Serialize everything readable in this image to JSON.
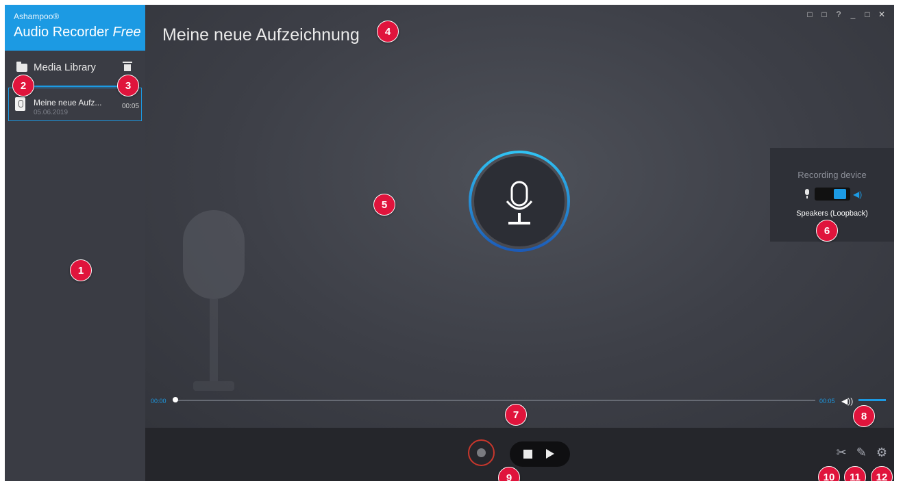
{
  "app": {
    "vendor": "Ashampoo®",
    "name": "Audio Recorder",
    "edition": "Free"
  },
  "library": {
    "label": "Media Library"
  },
  "recordings": [
    {
      "title": "Meine neue Aufz...",
      "date": "05.06.2019",
      "duration": "00:05"
    }
  ],
  "main": {
    "title": "Meine neue Aufzeichnung"
  },
  "device": {
    "header": "Recording device",
    "name": "Speakers (Loopback)"
  },
  "timeline": {
    "start": "00:00",
    "end": "00:05"
  },
  "window_controls": [
    "□",
    "□",
    "?",
    "_",
    "□",
    "✕"
  ],
  "badges": [
    "1",
    "2",
    "3",
    "4",
    "5",
    "6",
    "7",
    "8",
    "9",
    "10",
    "11",
    "12"
  ],
  "colors": {
    "accent": "#1c9ae3",
    "record": "#c9372c",
    "badge": "#e0143c"
  }
}
